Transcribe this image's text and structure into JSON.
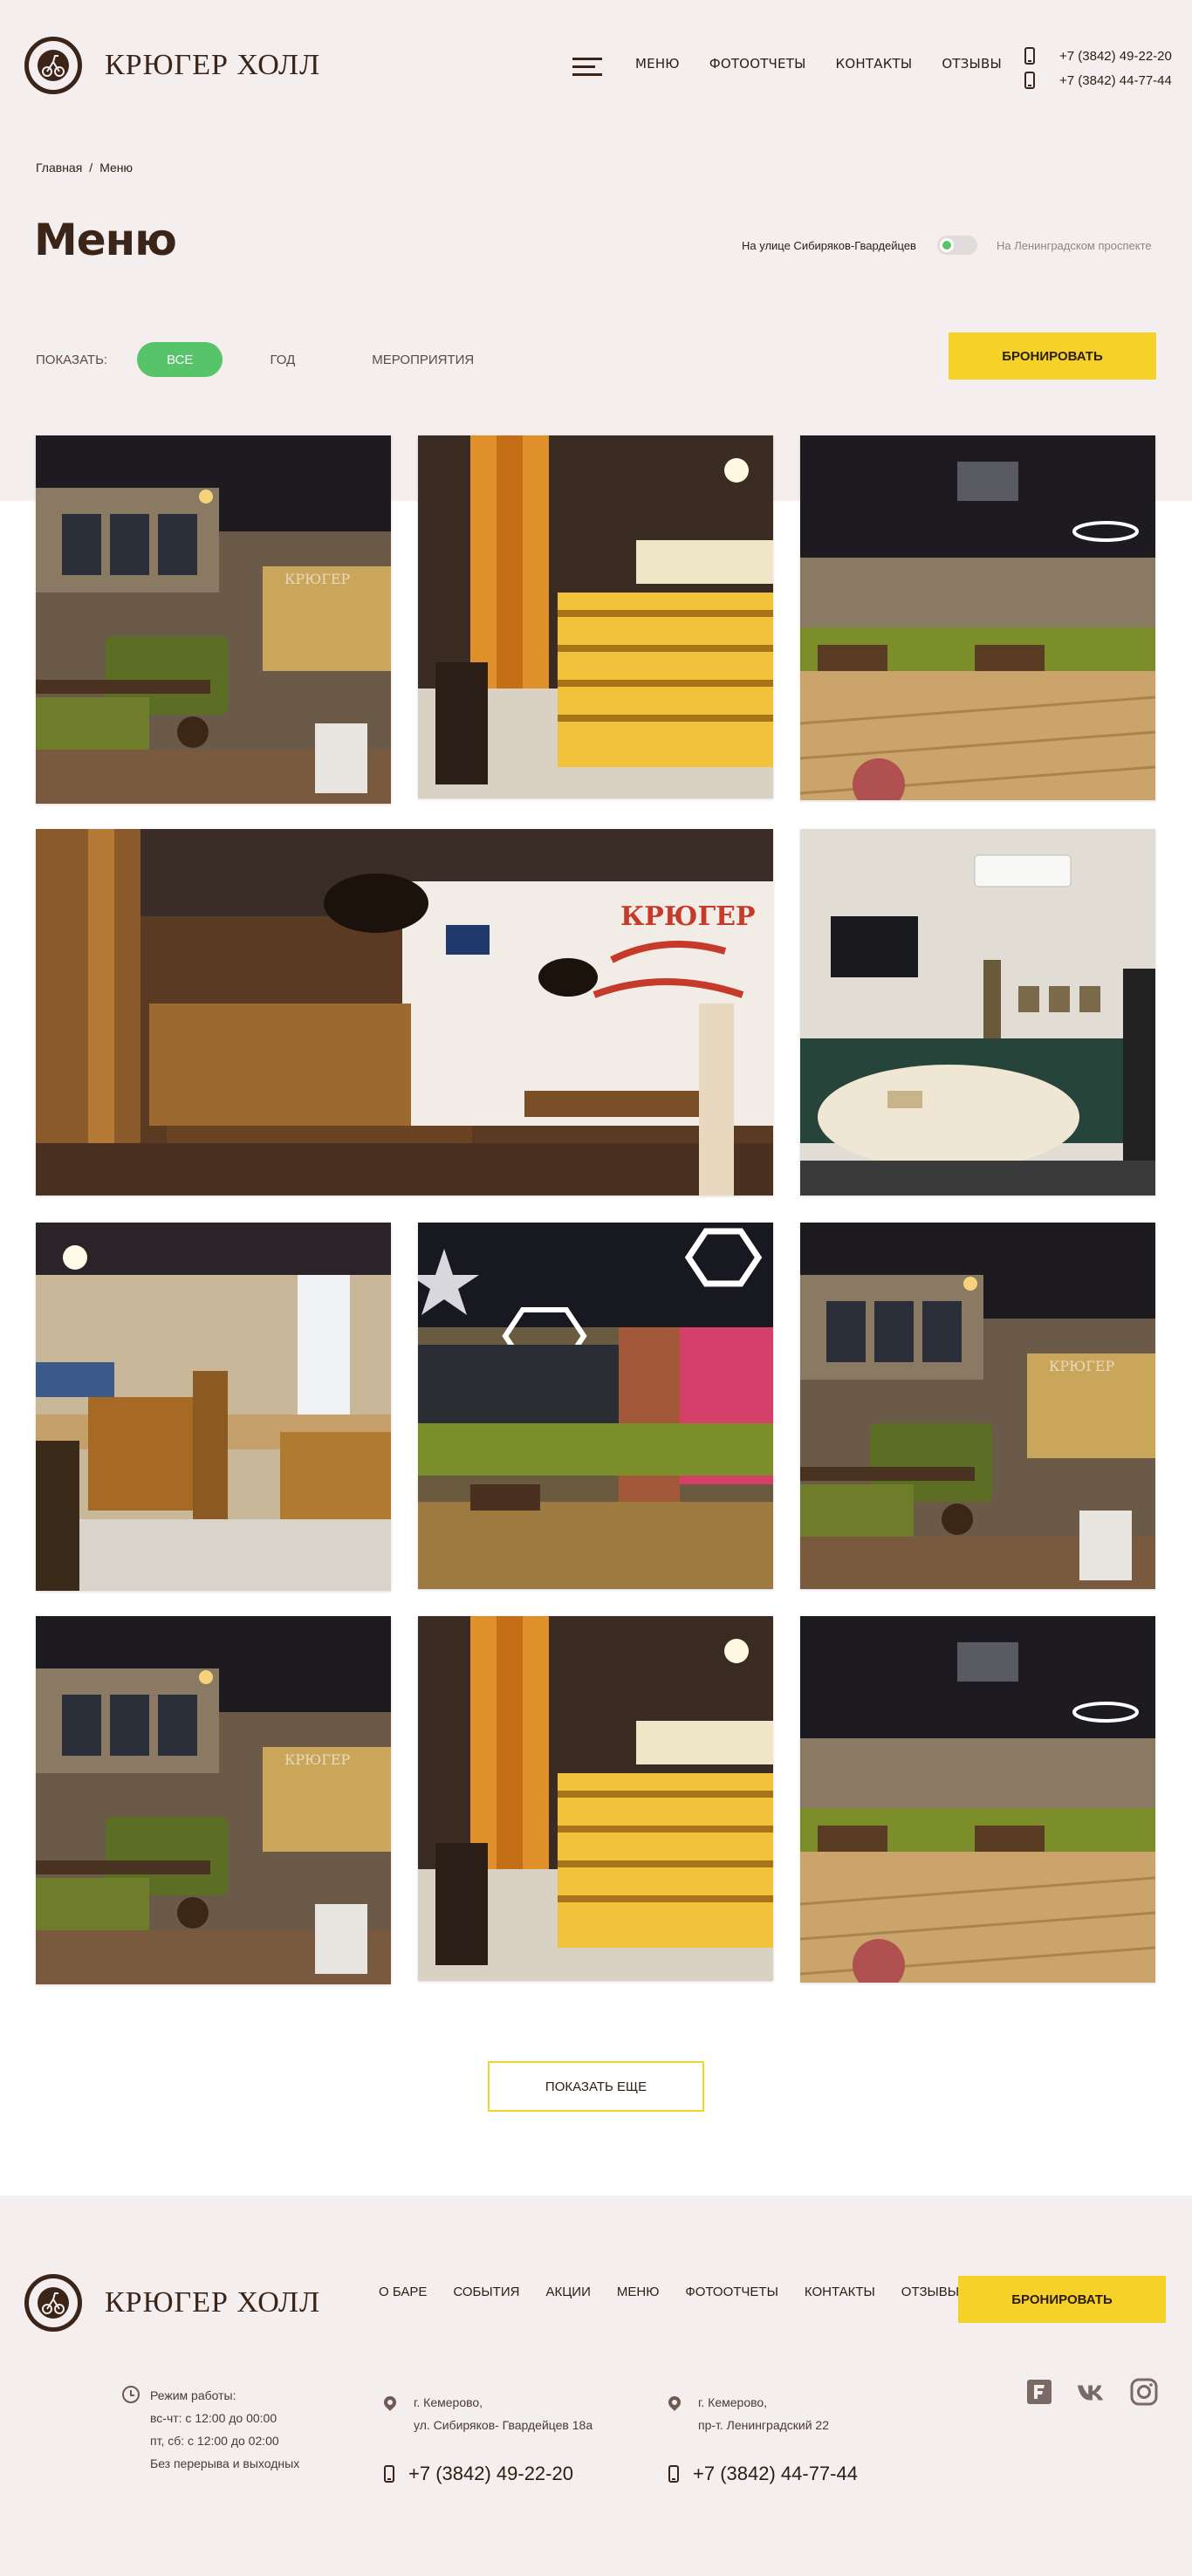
{
  "brand": {
    "name": "КРЮГЕР ХОЛЛ"
  },
  "header": {
    "nav": [
      "МЕНЮ",
      "ФОТООТЧЕТЫ",
      "КОНТАКТЫ",
      "ОТЗЫВЫ"
    ],
    "phones": [
      "+7 (3842) 49-22-20",
      "+7 (3842) 44-77-44"
    ]
  },
  "breadcrumb": {
    "home": "Главная",
    "separator": "/",
    "current": "Меню"
  },
  "page": {
    "title": "Меню"
  },
  "location_switch": {
    "left_label": "На улице Сибиряков-Гвардейцев",
    "right_label": "На Ленинградском проспекте"
  },
  "filter": {
    "label": "ПОКАЗАТЬ:",
    "options": [
      "ВСЕ",
      "ГОД",
      "МЕРОПРИЯТИЯ"
    ],
    "selected": "ВСЕ"
  },
  "actions": {
    "book": "БРОНИРОВАТЬ",
    "show_more": "ПОКАЗАТЬ ЕЩЕ"
  },
  "footer": {
    "nav": [
      "О БАРЕ",
      "СОБЫТИЯ",
      "АКЦИИ",
      "МЕНЮ",
      "ФОТООТЧЕТЫ",
      "КОНТАКТЫ",
      "ОТЗЫВЫ"
    ],
    "book": "БРОНИРОВАТЬ",
    "hours": [
      "Режим работы:",
      "вс-чт: с 12:00 до 00:00",
      "пт, сб: с 12:00 до 02:00",
      "Без перерыва и выходных"
    ],
    "address1": [
      "г. Кемерово,",
      "ул. Сибиряков- Гвардейцев 18а"
    ],
    "address2": [
      "г. Кемерово,",
      "пр-т. Ленинградский 22"
    ],
    "phone1": "+7 (3842) 49-22-20",
    "phone2": "+7 (3842) 44-77-44",
    "socials": [
      "foursquare-icon",
      "vk-icon",
      "instagram-icon"
    ]
  },
  "colors": {
    "accent_yellow": "#f6d228",
    "accent_green": "#57c46a",
    "brand_brown": "#3b2418",
    "background_light": "#f4eeee"
  }
}
